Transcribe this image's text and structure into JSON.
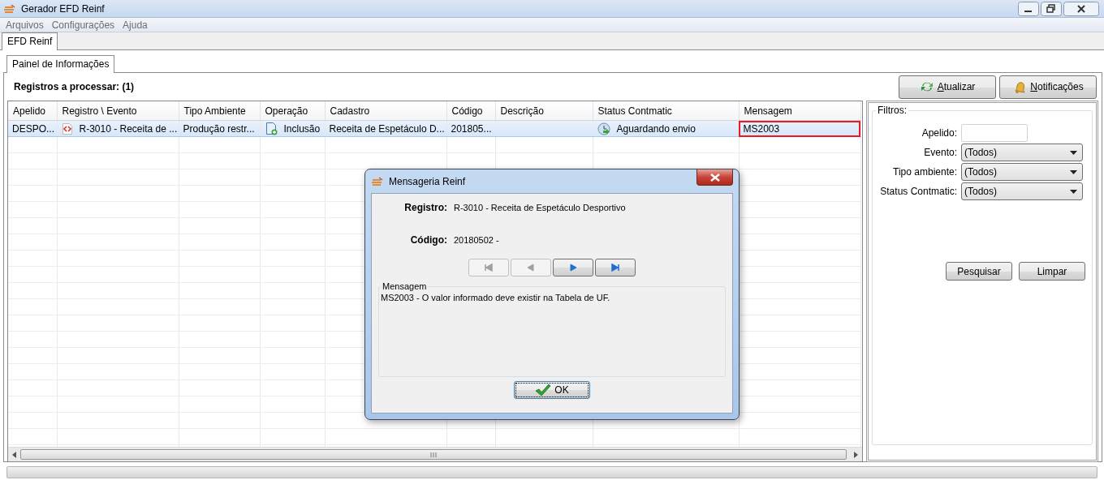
{
  "window": {
    "title": "Gerador EFD Reinf"
  },
  "menu": [
    "Arquivos",
    "Configurações",
    "Ajuda"
  ],
  "main_tabs": [
    {
      "label": "EFD Reinf",
      "selected": true
    }
  ],
  "panel_tabs": [
    {
      "label": "Painel de Informações",
      "selected": true
    }
  ],
  "heading": "Registros a processar: (1)",
  "toolbar": [
    {
      "label": "Atualizar",
      "kind": "refresh"
    },
    {
      "label": "Notificações",
      "kind": "bell"
    }
  ],
  "table": {
    "columns": [
      "Apelido",
      "Registro \\ Evento",
      "Tipo Ambiente",
      "Operação",
      "Cadastro",
      "Código",
      "Descrição",
      "Status Contmatic",
      "Mensagem"
    ],
    "rows": [
      {
        "selected": true,
        "cells": [
          {
            "kind": "text",
            "text": "DESPO..."
          },
          {
            "kind": "event",
            "text": "R-3010 - Receita de ..."
          },
          {
            "kind": "text",
            "text": "Produção restr..."
          },
          {
            "kind": "operation",
            "text": "Inclusão"
          },
          {
            "kind": "text",
            "text": "Receita de Espetáculo D..."
          },
          {
            "kind": "text",
            "text": "201805..."
          },
          {
            "kind": "text",
            "text": ""
          },
          {
            "kind": "status",
            "text": "Aguardando envio"
          },
          {
            "kind": "text",
            "text": "MS2003",
            "outlined": true
          }
        ]
      }
    ]
  },
  "filters": {
    "title": "Filtros:",
    "fields": [
      {
        "label": "Apelido:",
        "kind": "input"
      },
      {
        "label": "Evento:",
        "kind": "select",
        "value": "(Todos)"
      },
      {
        "label": "Tipo ambiente:",
        "kind": "select",
        "value": "(Todos)"
      },
      {
        "label": "Status Contmatic:",
        "kind": "select",
        "value": "(Todos)"
      }
    ],
    "buttons": [
      "Pesquisar",
      "Limpar"
    ]
  },
  "dialog": {
    "title": "Mensageria Reinf",
    "fields": [
      {
        "label": "Registro:",
        "value": "R-3010 - Receita de Espetáculo Desportivo"
      },
      {
        "label": "Código:",
        "value": "20180502 -"
      }
    ],
    "nav_buttons": [
      {
        "kind": "first",
        "disabled": true
      },
      {
        "kind": "prev",
        "disabled": true
      },
      {
        "kind": "next",
        "disabled": false
      },
      {
        "kind": "last",
        "disabled": false
      }
    ],
    "message_title": "Mensagem",
    "message": "MS2003 - O valor informado deve existir na Tabela de UF.",
    "ok": "OK"
  }
}
